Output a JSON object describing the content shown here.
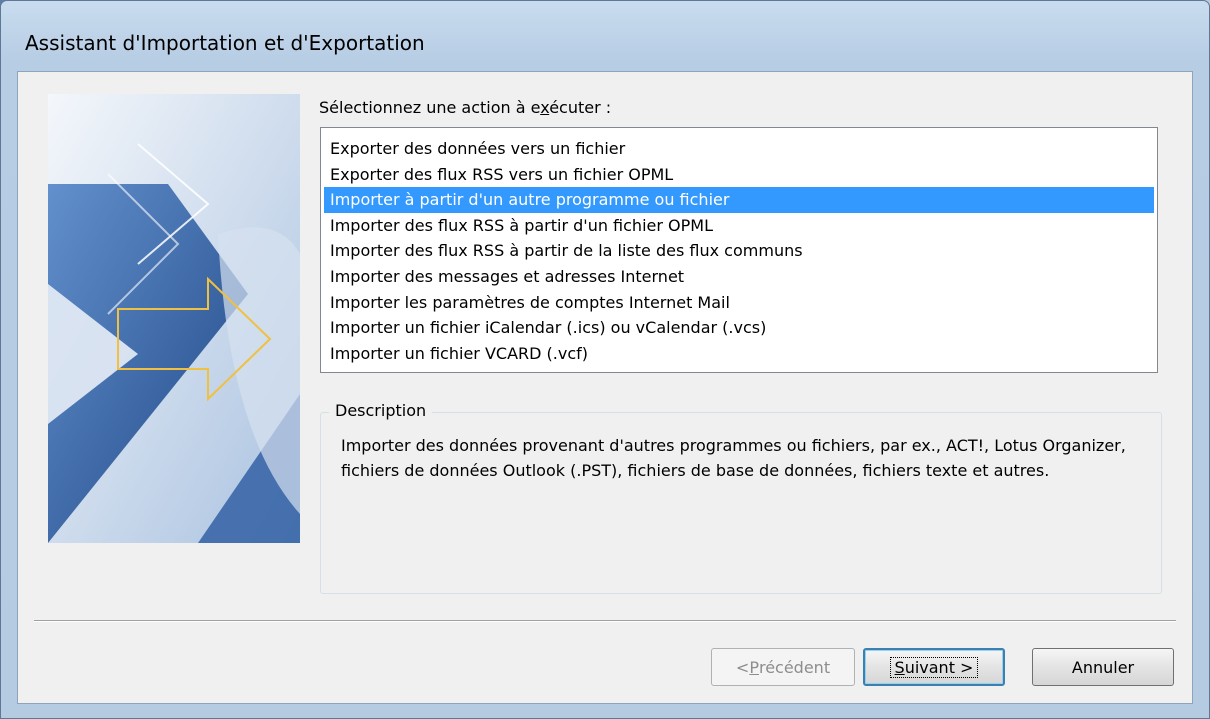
{
  "window": {
    "title": "Assistant d'Importation et d'Exportation"
  },
  "prompt": {
    "before": "Sélectionnez une action à e",
    "accel": "x",
    "after": "écuter :"
  },
  "actions": [
    "Exporter des données vers un fichier",
    "Exporter des flux RSS vers un fichier OPML",
    "Importer à partir d'un autre programme ou fichier",
    "Importer des flux RSS à partir d'un fichier OPML",
    "Importer des flux RSS à partir de la liste des flux communs",
    "Importer des messages et adresses Internet",
    "Importer les paramètres de comptes Internet Mail",
    "Importer un fichier iCalendar (.ics) ou vCalendar (.vcs)",
    "Importer un fichier VCARD (.vcf)"
  ],
  "selected_index": 2,
  "description": {
    "label": "Description",
    "text": "Importer des données provenant d'autres programmes ou fichiers, par ex., ACT!, Lotus Organizer, fichiers de données Outlook (.PST), fichiers de base de données, fichiers texte et autres."
  },
  "buttons": {
    "previous": {
      "before": "< ",
      "accel": "P",
      "after": "récédent",
      "enabled": false
    },
    "next": {
      "before": "",
      "accel": "S",
      "after": "uivant >"
    },
    "cancel": "Annuler"
  },
  "colors": {
    "selection": "#3399ff",
    "window_frame": "#b9cfe6",
    "client": "#f0f0f0"
  }
}
